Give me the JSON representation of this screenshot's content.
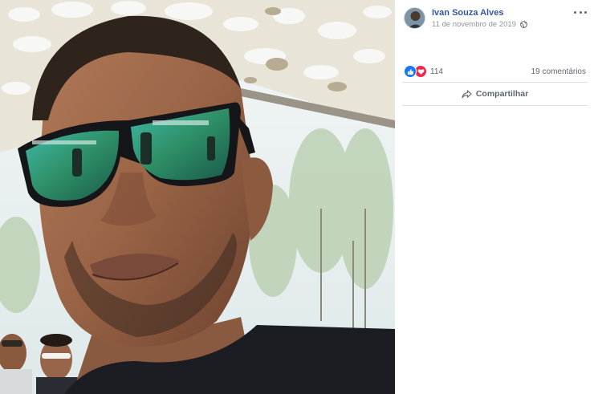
{
  "post": {
    "author_name": "Ivan Souza Alves",
    "date": "11 de novembro de 2019",
    "privacy_icon": "globe-icon",
    "more_icon": "more-options-icon"
  },
  "reactions": {
    "types": [
      "like",
      "love"
    ],
    "count": "114",
    "comments": "19 comentários"
  },
  "actions": {
    "share_label": "Compartilhar",
    "share_icon": "share-arrow-icon"
  },
  "colors": {
    "author_link": "#365899",
    "like": "#1877f2",
    "love": "#f0284a",
    "muted_text": "#606770",
    "meta_text": "#90949c"
  }
}
